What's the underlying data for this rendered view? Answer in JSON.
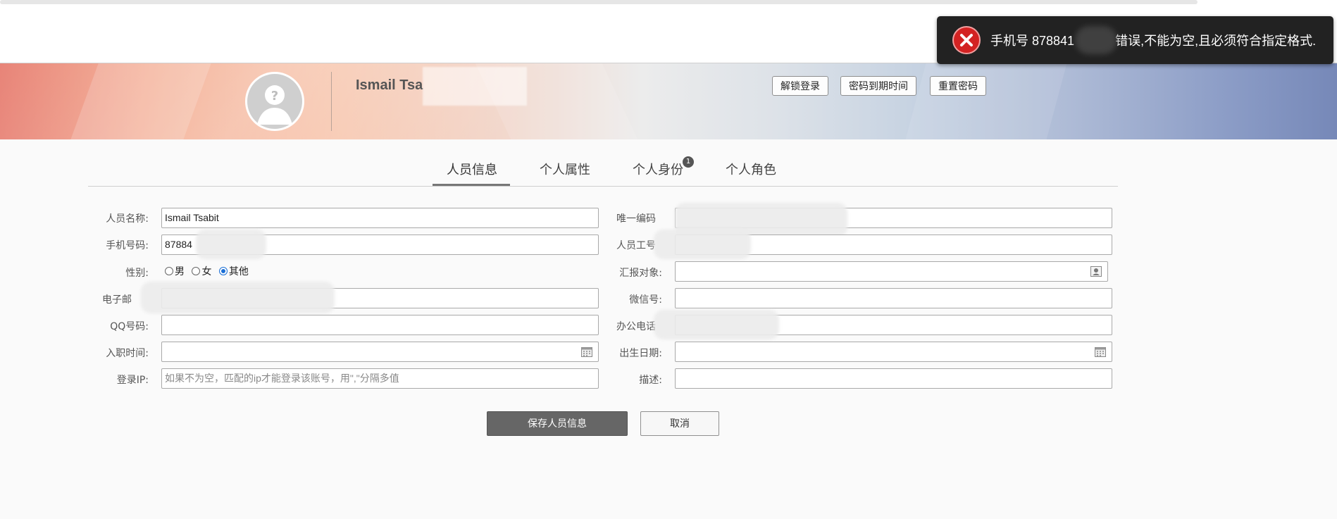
{
  "toast": {
    "text_prefix": "手机号 878841",
    "text_suffix": "错误,不能为空,且必须符合指定格式."
  },
  "header": {
    "user_name": "Ismail Tsa",
    "buttons": [
      "解锁登录",
      "密码到期时间",
      "重置密码"
    ]
  },
  "tabs": [
    {
      "label": "人员信息",
      "active": true
    },
    {
      "label": "个人属性",
      "active": false
    },
    {
      "label": "个人身份",
      "active": false,
      "badge": "1"
    },
    {
      "label": "个人角色",
      "active": false
    }
  ],
  "form": {
    "name_label": "人员名称:",
    "name_value": "Ismail Tsabit",
    "code_label": "唯一编码",
    "phone_label": "手机号码:",
    "phone_value": "87884",
    "staffno_label": "人员工号",
    "gender_label": "性别:",
    "gender_options": [
      "男",
      "女",
      "其他"
    ],
    "gender_selected": "其他",
    "report_label": "汇报对象:",
    "email_label": "电子邮",
    "wechat_label": "微信号:",
    "qq_label": "QQ号码:",
    "office_phone_label": "办公电话",
    "hire_date_label": "入职时间:",
    "birth_date_label": "出生日期:",
    "ip_label": "登录IP:",
    "ip_placeholder": "如果不为空，匹配的ip才能登录该账号，用\",\"分隔多值",
    "desc_label": "描述:"
  },
  "actions": {
    "save_label": "保存人员信息",
    "cancel_label": "取消"
  },
  "icons": {
    "toast": "close-error-icon",
    "avatar": "default-avatar-icon",
    "calendar": "calendar-icon",
    "person_picker": "person-picker-icon"
  },
  "colors": {
    "toast_bg": "#222222",
    "error_red": "#d32222",
    "primary_button": "#666666",
    "radio_accent": "#1a6fd6"
  }
}
